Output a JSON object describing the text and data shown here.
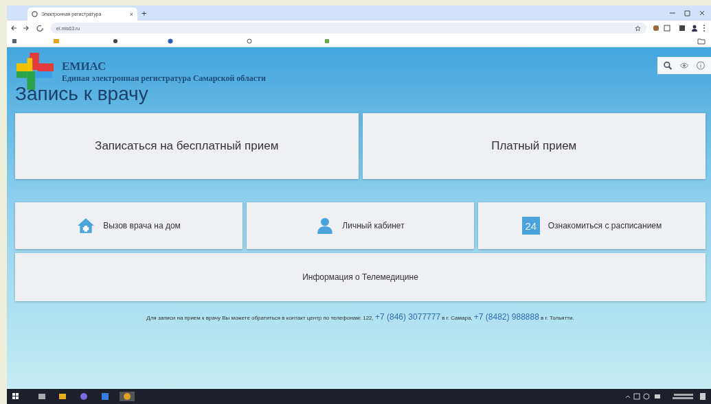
{
  "browser": {
    "tab_title": "Электронная регистратура",
    "tab_close": "×",
    "new_tab": "+",
    "url": "el.mis63.ru"
  },
  "header": {
    "logo_title": "ЕМИАС",
    "logo_subtitle": "Единая электронная регистратура Самарской области"
  },
  "page_title": "Запись к врачу",
  "main_tiles": [
    {
      "label": "Записаться на бесплатный прием"
    },
    {
      "label": "Платный прием"
    }
  ],
  "small_tiles": [
    {
      "kind": "house",
      "label": "Вызов врача на дом"
    },
    {
      "kind": "person",
      "label": "Личный кабинет"
    },
    {
      "kind": "calendar",
      "label": "Ознакомиться с расписанием",
      "badge": "24"
    }
  ],
  "wide_tile": {
    "label": "Информация о Телемедицине"
  },
  "footer": {
    "text": "Для записи на прием к врачу Вы можете обратиться в контакт центр по телефонам: 122,",
    "phone_1": "+7 (846) 3077777",
    "city_1": "в г. Самара,",
    "phone_2": "+7 (8482) 988888",
    "city_2": "в г. Тольятти."
  }
}
